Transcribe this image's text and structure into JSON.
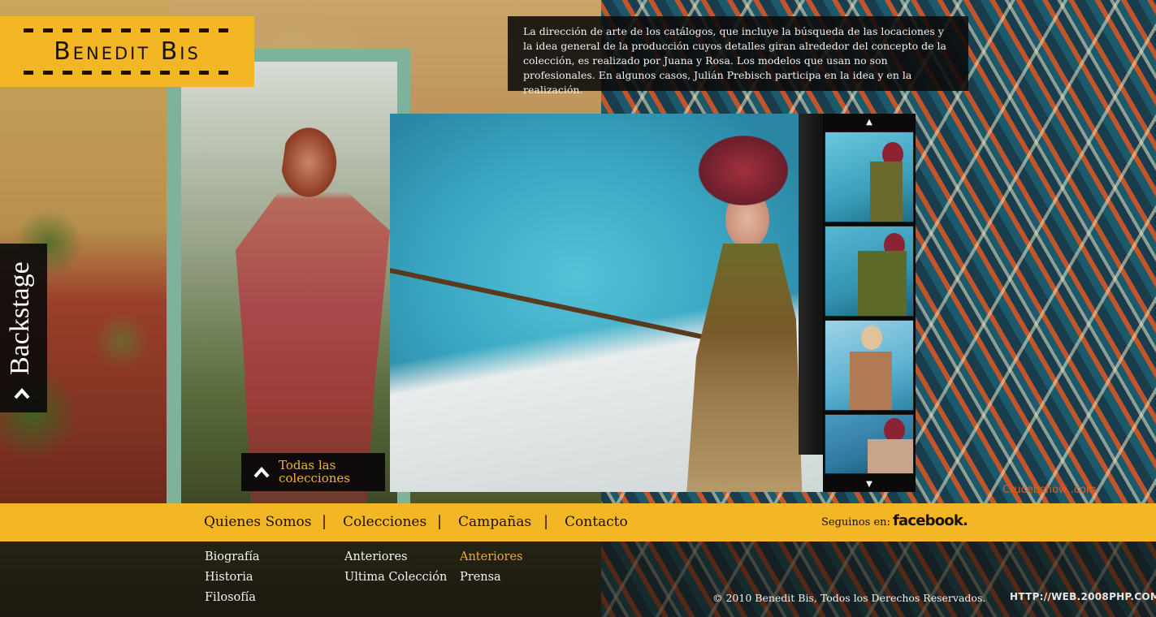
{
  "brand": {
    "name": "Benedit Bis"
  },
  "description": {
    "text": "La dirección de arte de los catálogos, que incluye la búsqueda de las locaciones y la idea general de la producción cuyos detalles giran alrededor del concepto de la colección, es realizado por Juana y Rosa. Los modelos que usan no son profesionales. En algunos casos, Julián Prebisch participa en la idea y en la realización."
  },
  "backstage": {
    "label": "Backstage"
  },
  "gallery": {
    "up_arrow": "▲",
    "down_arrow": "▼",
    "thumbnails": 4
  },
  "collections_button": {
    "label_line1": "Todas las",
    "label_line2": "colecciones"
  },
  "credit": {
    "text": "Crucebshow .com"
  },
  "nav": {
    "items": [
      "Quienes Somos",
      "Colecciones",
      "Campañas",
      "Contacto"
    ],
    "separator": "|",
    "follow_label": "Seguinos en:",
    "facebook_label": "facebook."
  },
  "submenus": {
    "quienes_somos": [
      "Biografía",
      "Historia",
      "Filosofía"
    ],
    "colecciones": [
      "Anteriores",
      "Ultima Colección"
    ],
    "campanas": [
      "Anteriores",
      "Prensa"
    ]
  },
  "footer": {
    "copyright": "© 2010 Benedit Bis, Todos los Derechos Reservados.",
    "site_mark": "HTTP://WEB.2008PHP.COM"
  },
  "colors": {
    "accent_yellow": "#f3b625",
    "accent_orange": "#f3a83a",
    "panel_dark": "#0a0a0a"
  }
}
